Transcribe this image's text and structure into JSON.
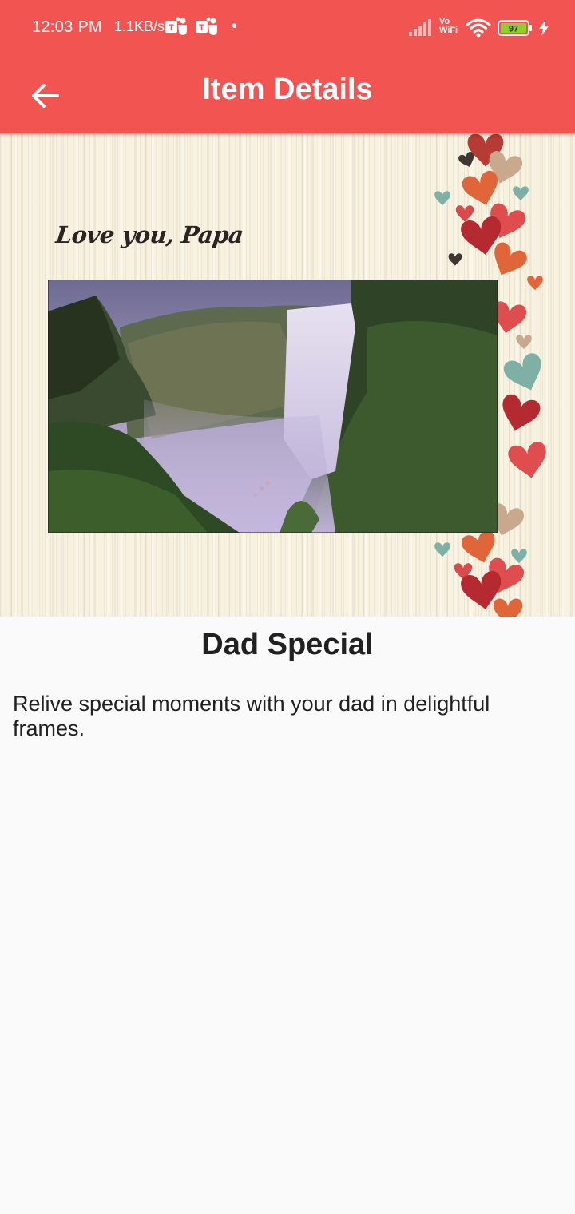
{
  "status_bar": {
    "time": "12:03 PM",
    "network_speed": "1.1KB/s",
    "dot": "•",
    "vo_label": "Vo",
    "wifi_label": "WiFi",
    "battery_level": "97",
    "icons": [
      "teams-icon",
      "teams-icon",
      "signal-icon",
      "vowifi-icon",
      "wifi-icon",
      "battery-icon",
      "charging-icon"
    ]
  },
  "app_bar": {
    "title": "Item Details",
    "back_icon": "arrow-left-icon",
    "background_color": "#f25452"
  },
  "hero": {
    "caption": "Love you, Papa",
    "photo": "waterfall-landscape",
    "decoration": "hearts"
  },
  "item": {
    "title": "Dad Special",
    "description": "Relive special moments with your dad in delightful frames."
  }
}
